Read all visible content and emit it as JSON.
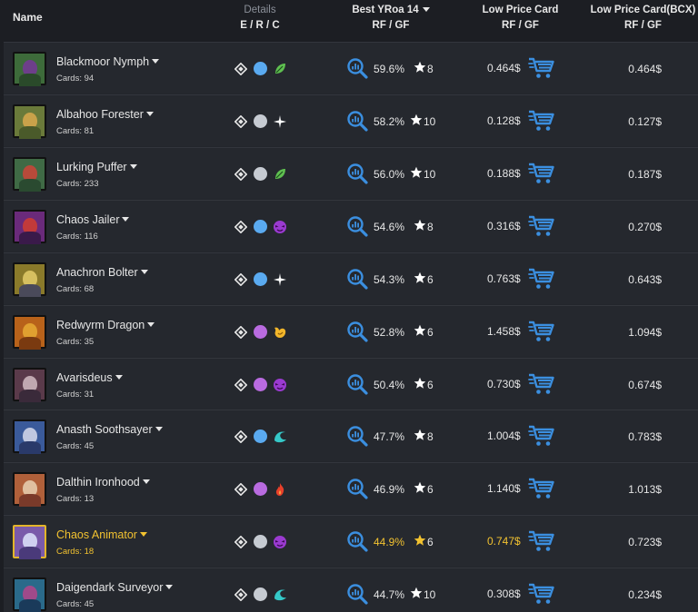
{
  "header": {
    "name": "Name",
    "details_top": "Details",
    "details_bot": "E / R / C",
    "best_top": "Best YRoa 14",
    "best_bot": "RF / GF",
    "low_top": "Low Price Card",
    "low_bot": "RF / GF",
    "bcx_top": "Low Price Card(BCX)",
    "bcx_bot": "RF / GF"
  },
  "colors": {
    "accent_blue": "#3b8fe0",
    "highlight_gold": "#f2c230",
    "rarity_common": "#c6cbd2",
    "rarity_rare": "#5aaaf0",
    "rarity_epic": "#b96be0"
  },
  "rows": [
    {
      "name": "Blackmoor Nymph",
      "cards_label": "Cards:",
      "cards": "94",
      "rarity": "rare",
      "element": "earth-icon",
      "yroa": "59.6%",
      "gf": "8",
      "price": "0.464$",
      "bcx": "0.464$",
      "thumb": [
        "#3d6b3a",
        "#6d3f8a",
        "#2a4a2a"
      ]
    },
    {
      "name": "Albahoo Forester",
      "cards_label": "Cards:",
      "cards": "81",
      "rarity": "common",
      "element": "life-icon",
      "yroa": "58.2%",
      "gf": "10",
      "price": "0.128$",
      "bcx": "0.127$",
      "thumb": [
        "#6a7a3a",
        "#c9a24a",
        "#4a5a2a"
      ]
    },
    {
      "name": "Lurking Puffer",
      "cards_label": "Cards:",
      "cards": "233",
      "rarity": "common",
      "element": "earth-icon",
      "yroa": "56.0%",
      "gf": "10",
      "price": "0.188$",
      "bcx": "0.187$",
      "thumb": [
        "#3f6a45",
        "#b84a3a",
        "#2a4a30"
      ]
    },
    {
      "name": "Chaos Jailer",
      "cards_label": "Cards:",
      "cards": "116",
      "rarity": "rare",
      "element": "death-icon",
      "yroa": "54.6%",
      "gf": "8",
      "price": "0.316$",
      "bcx": "0.270$",
      "thumb": [
        "#6a2a7a",
        "#c23a3a",
        "#3a1a4a"
      ]
    },
    {
      "name": "Anachron Bolter",
      "cards_label": "Cards:",
      "cards": "68",
      "rarity": "rare",
      "element": "life-icon",
      "yroa": "54.3%",
      "gf": "6",
      "price": "0.763$",
      "bcx": "0.643$",
      "thumb": [
        "#8a7a2a",
        "#d6c060",
        "#4a4a5a"
      ]
    },
    {
      "name": "Redwyrm Dragon",
      "cards_label": "Cards:",
      "cards": "35",
      "rarity": "epic",
      "element": "dragon-icon",
      "yroa": "52.8%",
      "gf": "6",
      "price": "1.458$",
      "bcx": "1.094$",
      "thumb": [
        "#b8621a",
        "#e0a030",
        "#7a3a10"
      ]
    },
    {
      "name": "Avarisdeus",
      "cards_label": "Cards:",
      "cards": "31",
      "rarity": "epic",
      "element": "death-icon",
      "yroa": "50.4%",
      "gf": "6",
      "price": "0.730$",
      "bcx": "0.674$",
      "thumb": [
        "#5a3a4a",
        "#c0a8b0",
        "#3a2a3a"
      ]
    },
    {
      "name": "Anasth Soothsayer",
      "cards_label": "Cards:",
      "cards": "45",
      "rarity": "rare",
      "element": "water-icon",
      "yroa": "47.7%",
      "gf": "8",
      "price": "1.004$",
      "bcx": "0.783$",
      "thumb": [
        "#3a5a9a",
        "#c0c8e0",
        "#2a3a6a"
      ]
    },
    {
      "name": "Dalthin Ironhood",
      "cards_label": "Cards:",
      "cards": "13",
      "rarity": "epic",
      "element": "fire-icon",
      "yroa": "46.9%",
      "gf": "6",
      "price": "1.140$",
      "bcx": "1.013$",
      "thumb": [
        "#b0603a",
        "#e0c0a0",
        "#7a3a2a"
      ]
    },
    {
      "name": "Chaos Animator",
      "cards_label": "Cards:",
      "cards": "18",
      "rarity": "common",
      "element": "death-icon",
      "yroa": "44.9%",
      "gf": "6",
      "price": "0.747$",
      "bcx": "0.723$",
      "highlight": true,
      "thumb": [
        "#7a5aaa",
        "#d0d0f0",
        "#4a3a7a"
      ]
    },
    {
      "name": "Daigendark Surveyor",
      "cards_label": "Cards:",
      "cards": "45",
      "rarity": "common",
      "element": "water-icon",
      "yroa": "44.7%",
      "gf": "10",
      "price": "0.308$",
      "bcx": "0.234$",
      "thumb": [
        "#2a6a8a",
        "#a04a8a",
        "#1a3a5a"
      ]
    }
  ]
}
